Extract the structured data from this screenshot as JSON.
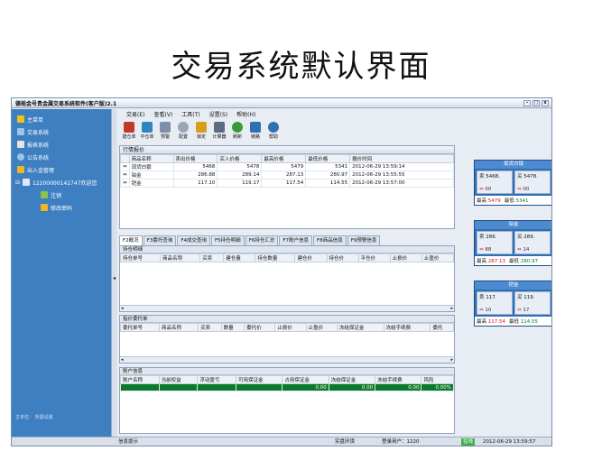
{
  "slide_title": "交易系统默认界面",
  "window": {
    "title": "德裕金号贵金属交易系统软件(客户版)2.1",
    "controls": [
      "-",
      "□",
      "x"
    ]
  },
  "sidebar": {
    "items": [
      {
        "label": "主菜单",
        "icon": "home-icon",
        "level": 1
      },
      {
        "label": "交易系统",
        "icon": "monitor-icon",
        "level": 1
      },
      {
        "label": "报表系统",
        "icon": "report-icon",
        "level": 1
      },
      {
        "label": "公告系统",
        "icon": "bell-icon",
        "level": 1
      },
      {
        "label": "出入金管理",
        "icon": "money-icon",
        "level": 1
      },
      {
        "label": "12200000142747欢迎您",
        "icon": "user-icon",
        "level": 2
      },
      {
        "label": "注销",
        "icon": "logout-icon",
        "level": 3
      },
      {
        "label": "修改密码",
        "icon": "key-icon",
        "level": 3
      }
    ],
    "footer": "主单位：    所需设置"
  },
  "menubar": [
    "交易(E)",
    "查看(V)",
    "工具(T)",
    "设置(S)",
    "帮助(H)"
  ],
  "toolbar": [
    {
      "label": "建仓单",
      "icon": "chart-bar-icon",
      "color": "#c0392b"
    },
    {
      "label": "平仓单",
      "icon": "chart-bar-icon",
      "color": "#2e86c1"
    },
    {
      "label": "预警",
      "icon": "warning-icon",
      "color": "#7d8fa8"
    },
    {
      "label": "配置",
      "icon": "gear-icon",
      "color": "#9aa6b8"
    },
    {
      "label": "锁定",
      "icon": "lock-icon",
      "color": "#d4a017"
    },
    {
      "label": "计算器",
      "icon": "calculator-icon",
      "color": "#5a6b82"
    },
    {
      "label": "刷新",
      "icon": "refresh-icon",
      "color": "#3a9a3a"
    },
    {
      "label": "链路",
      "icon": "link-icon",
      "color": "#2f6fb6"
    },
    {
      "label": "帮助",
      "icon": "help-icon",
      "color": "#2f6fb6"
    }
  ],
  "quotes_panel": {
    "title": "行情报价",
    "columns": [
      "商品名称",
      "卖出价格",
      "买入价格",
      "最高价格",
      "最低价格",
      "报价时间"
    ],
    "rows": [
      {
        "name": "现货白银",
        "sell": "5468",
        "buy": "5478",
        "high": "5479",
        "low": "5341",
        "time": "2012-06-29 13:59:14"
      },
      {
        "name": "铂金",
        "sell": "286.88",
        "buy": "289.14",
        "high": "287.13",
        "low": "280.97",
        "time": "2012-06-29 13:55:55"
      },
      {
        "name": "钯金",
        "sell": "117.10",
        "buy": "119.17",
        "high": "117.54",
        "low": "114.55",
        "time": "2012-06-29 13:57:00"
      }
    ]
  },
  "tabs": [
    "F2概况",
    "F3委托查询",
    "F4成交查询",
    "F5持仓明细",
    "F6持仓汇总",
    "F7账户信息",
    "F8商品信息",
    "F9预警信息"
  ],
  "positions": {
    "title": "持仓明细",
    "columns": [
      "持仓单号",
      "商品名称",
      "买卖",
      "建仓量",
      "持仓数量",
      "建仓价",
      "持仓价",
      "平仓价",
      "止损价",
      "止盈价"
    ]
  },
  "orders": {
    "title": "指价委托单",
    "columns": [
      "委托单号",
      "商品名称",
      "买卖",
      "数量",
      "委托价",
      "止损价",
      "止盈价",
      "冻结保证金",
      "冻结手续费",
      "委托"
    ]
  },
  "account": {
    "title": "账户信息",
    "columns": [
      "账户名称",
      "当前权益",
      "浮动盈亏",
      "可用保证金",
      "占用保证金",
      "冻结保证金",
      "冻结手续费",
      "风险"
    ],
    "row": [
      "",
      "",
      "",
      "",
      "0.00",
      "0.00",
      "0.00",
      "0.00%"
    ]
  },
  "quote_cards": [
    {
      "title": "现货白银",
      "sell_label": "卖",
      "sell": "5468.",
      "buy_label": "买",
      "buy": "5478.",
      "sell_sub": "00",
      "buy_sub": "00",
      "high_label": "最高",
      "high": "5479",
      "low_label": "最低",
      "low": "5341"
    },
    {
      "title": "铂金",
      "sell_label": "卖",
      "sell": "286.",
      "buy_label": "买",
      "buy": "289.",
      "sell_sub": "88",
      "buy_sub": "14",
      "high_label": "最高",
      "high": "287.13",
      "low_label": "最低",
      "low": "280.97"
    },
    {
      "title": "钯金",
      "sell_label": "卖",
      "sell": "117.",
      "buy_label": "买",
      "buy": "119.",
      "sell_sub": "10",
      "buy_sub": "17",
      "high_label": "最高",
      "high": "117.54",
      "low_label": "最低",
      "low": "114.55"
    }
  ],
  "statusbar": {
    "left": "信息提示",
    "center": "实盘环境",
    "user": "登录用户：1220",
    "online": "在线",
    "datetime": "2012-06-29 13:59:57"
  }
}
